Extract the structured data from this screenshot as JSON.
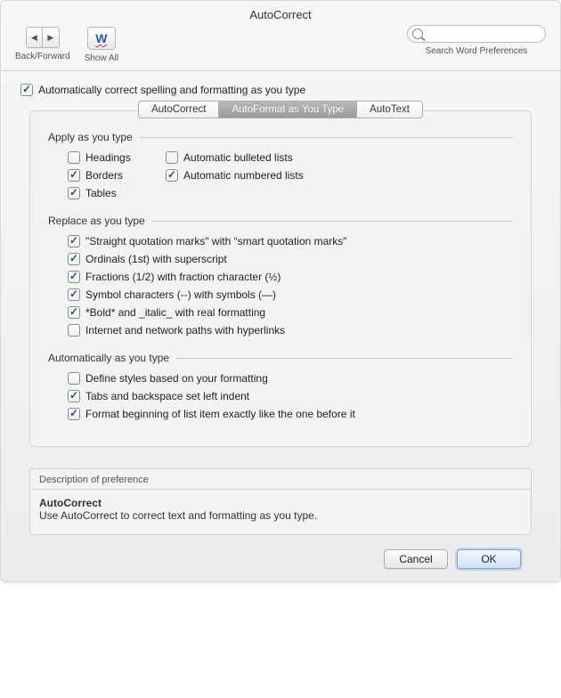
{
  "window": {
    "title": "AutoCorrect"
  },
  "toolbar": {
    "backforward_label": "Back/Forward",
    "showall_label": "Show All",
    "search_label": "Search Word Preferences"
  },
  "topCheckbox": {
    "label": "Automatically correct spelling and formatting as you type",
    "checked": true
  },
  "tabs": {
    "items": [
      {
        "label": "AutoCorrect"
      },
      {
        "label": "AutoFormat as You Type"
      },
      {
        "label": "AutoText"
      }
    ]
  },
  "sections": {
    "apply": {
      "title": "Apply as you type",
      "colA": [
        {
          "label": "Headings",
          "checked": false
        },
        {
          "label": "Borders",
          "checked": true
        },
        {
          "label": "Tables",
          "checked": true
        }
      ],
      "colB": [
        {
          "label": "Automatic bulleted lists",
          "checked": false
        },
        {
          "label": "Automatic numbered lists",
          "checked": true
        }
      ]
    },
    "replace": {
      "title": "Replace as you type",
      "items": [
        {
          "label": "\"Straight quotation marks\" with “smart quotation marks”",
          "checked": true
        },
        {
          "label": "Ordinals (1st) with superscript",
          "checked": true
        },
        {
          "label": "Fractions (1/2) with fraction character (½)",
          "checked": true
        },
        {
          "label": "Symbol characters (--) with symbols (—)",
          "checked": true
        },
        {
          "label": "*Bold* and _italic_ with real formatting",
          "checked": true
        },
        {
          "label": "Internet and network paths with hyperlinks",
          "checked": false
        }
      ]
    },
    "auto": {
      "title": "Automatically as you type",
      "items": [
        {
          "label": "Define styles based on your formatting",
          "checked": false
        },
        {
          "label": "Tabs and backspace set left indent",
          "checked": true
        },
        {
          "label": "Format beginning of list item exactly like the one before it",
          "checked": true
        }
      ]
    }
  },
  "description": {
    "title": "Description of preference",
    "heading": "AutoCorrect",
    "body": "Use AutoCorrect to correct text and formatting as you type."
  },
  "footer": {
    "cancel": "Cancel",
    "ok": "OK"
  }
}
